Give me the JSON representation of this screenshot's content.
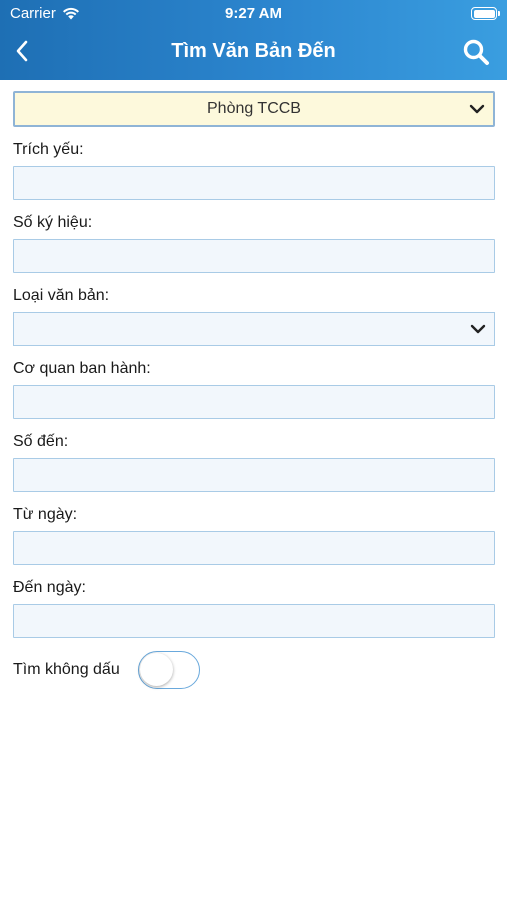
{
  "status_bar": {
    "carrier": "Carrier",
    "time": "9:27 AM"
  },
  "nav": {
    "title": "Tìm Văn Bản Đến"
  },
  "department_select": {
    "selected": "Phòng TCCB"
  },
  "fields": {
    "trich_yeu": {
      "label": "Trích yếu:",
      "value": ""
    },
    "so_ky_hieu": {
      "label": "Số ký hiệu:",
      "value": ""
    },
    "loai_van_ban": {
      "label": "Loại văn bản:",
      "selected": ""
    },
    "co_quan_ban_hanh": {
      "label": "Cơ quan ban hành:",
      "value": ""
    },
    "so_den": {
      "label": "Số đến:",
      "value": ""
    },
    "tu_ngay": {
      "label": "Từ ngày:",
      "value": ""
    },
    "den_ngay": {
      "label": "Đến ngày:",
      "value": ""
    }
  },
  "toggle": {
    "label": "Tìm không dấu",
    "on": false
  },
  "colors": {
    "header_start": "#1e6fb4",
    "header_end": "#3a9ee0",
    "input_bg": "#f2f7fc",
    "input_border": "#a9cbe6",
    "select_bg": "#fdf9dc"
  },
  "icons": {
    "back": "chevron-left-icon",
    "search": "search-icon",
    "dropdown": "chevron-down-icon",
    "wifi": "wifi-icon",
    "battery": "battery-icon"
  }
}
